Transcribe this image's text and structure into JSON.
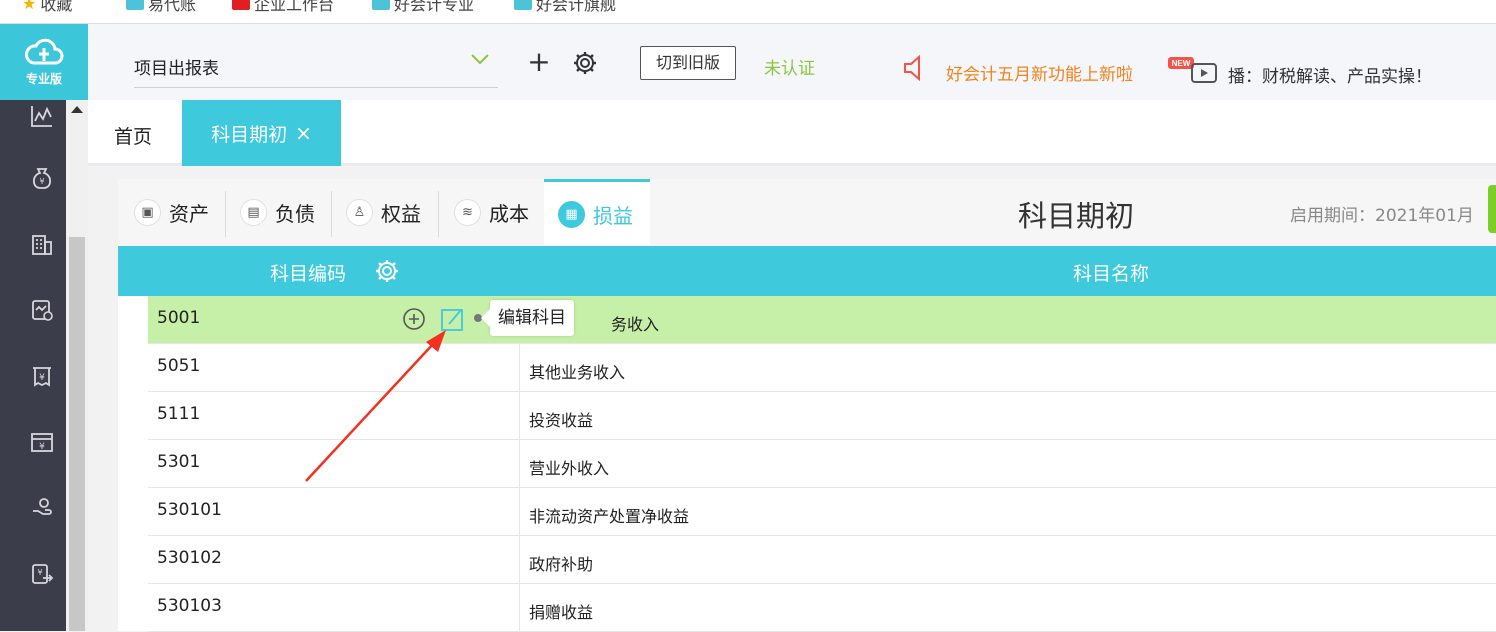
{
  "bookmarks": {
    "items": [
      "收藏",
      "易代账",
      "企业工作台",
      "好会计专业",
      "好会计旗舰"
    ]
  },
  "logo": {
    "label": "专业版"
  },
  "header": {
    "report_select": "项目出报表",
    "switch_old_label": "切到旧版",
    "auth_status": "未认证",
    "announcement": "好会计五月新功能上新啦",
    "live_badge": "NEW",
    "live_text": "播：财税解读、产品实操！"
  },
  "tabs": {
    "home": "首页",
    "active": "科目期初",
    "close": "×"
  },
  "main": {
    "title": "科目期初",
    "period": "启用期间：2021年01月",
    "categories": [
      {
        "label": "资产"
      },
      {
        "label": "负债"
      },
      {
        "label": "权益"
      },
      {
        "label": "成本"
      },
      {
        "label": "损益"
      }
    ],
    "active_category": "损益",
    "columns": {
      "code": "科目编码",
      "name": "科目名称"
    },
    "tooltip": "编辑科目",
    "rows": [
      {
        "code": "5001",
        "name": "务收入"
      },
      {
        "code": "5051",
        "name": "其他业务收入"
      },
      {
        "code": "5111",
        "name": "投资收益"
      },
      {
        "code": "5301",
        "name": "营业外收入"
      },
      {
        "code": "530101",
        "name": "非流动资产处置净收益"
      },
      {
        "code": "530102",
        "name": "政府补助"
      },
      {
        "code": "530103",
        "name": "捐赠收益"
      }
    ]
  },
  "colors": {
    "accent": "#3ec9dd",
    "sidebar": "#3c3d4b",
    "highlight_row": "#c6f0a8",
    "status_green": "#8cc63f",
    "announce_orange": "#f0831e",
    "arrow_red": "#f4311f"
  },
  "icons": {
    "sidebar": [
      "chart-icon",
      "money-bag-icon",
      "building-icon",
      "finance-report-icon",
      "receipt-icon",
      "cashier-icon",
      "hand-money-icon",
      "export-icon"
    ]
  }
}
